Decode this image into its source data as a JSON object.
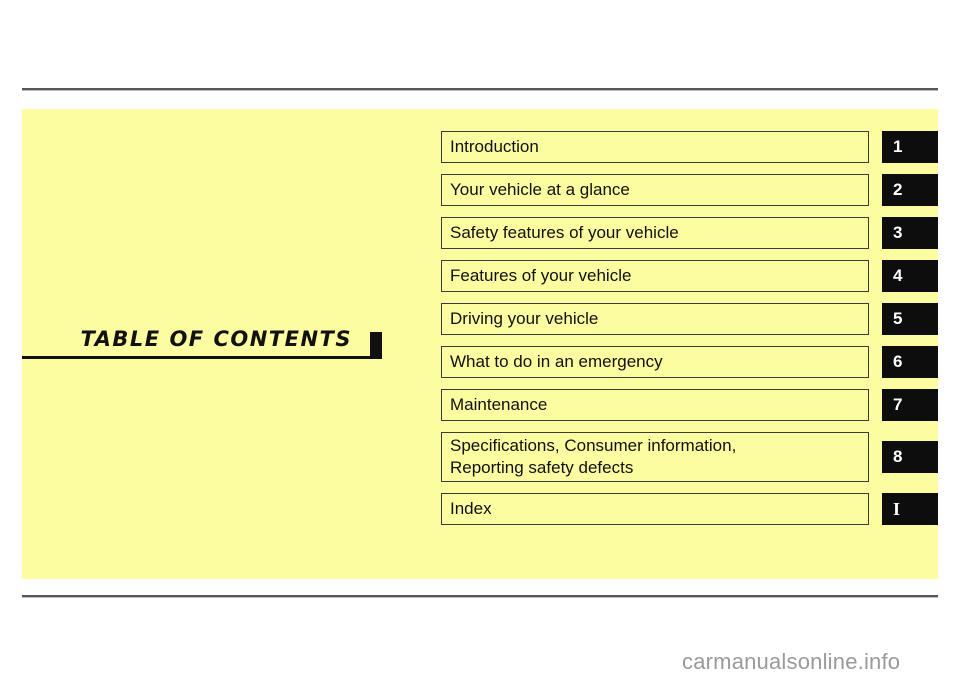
{
  "page": {
    "background_color": "#ffffff",
    "panel_color": "#fcfca0",
    "rule_color": "#555759",
    "rule_shadow_color": "#b9bbbd",
    "ink_color": "#111111"
  },
  "toc": {
    "title": "TABLE  OF  CONTENTS",
    "marker_icon": "title-end-block-icon",
    "rows": [
      {
        "label": "Introduction",
        "tab": "1",
        "tab_style": "sans",
        "two_line": false
      },
      {
        "label": "Your vehicle at a glance",
        "tab": "2",
        "tab_style": "sans",
        "two_line": false
      },
      {
        "label": "Safety features of your vehicle",
        "tab": "3",
        "tab_style": "sans",
        "two_line": false
      },
      {
        "label": "Features of your vehicle",
        "tab": "4",
        "tab_style": "sans",
        "two_line": false
      },
      {
        "label": "Driving your vehicle",
        "tab": "5",
        "tab_style": "sans",
        "two_line": false
      },
      {
        "label": "What to do in an emergency",
        "tab": "6",
        "tab_style": "sans",
        "two_line": false
      },
      {
        "label": "Maintenance",
        "tab": "7",
        "tab_style": "sans",
        "two_line": false
      },
      {
        "label": "Specifications, Consumer information,\nReporting safety defects",
        "tab": "8",
        "tab_style": "sans",
        "two_line": true
      },
      {
        "label": "Index",
        "tab": "I",
        "tab_style": "serif",
        "two_line": false
      }
    ]
  },
  "watermark": {
    "text": "carmanualsonline.info",
    "color": "#9a9a9a"
  }
}
